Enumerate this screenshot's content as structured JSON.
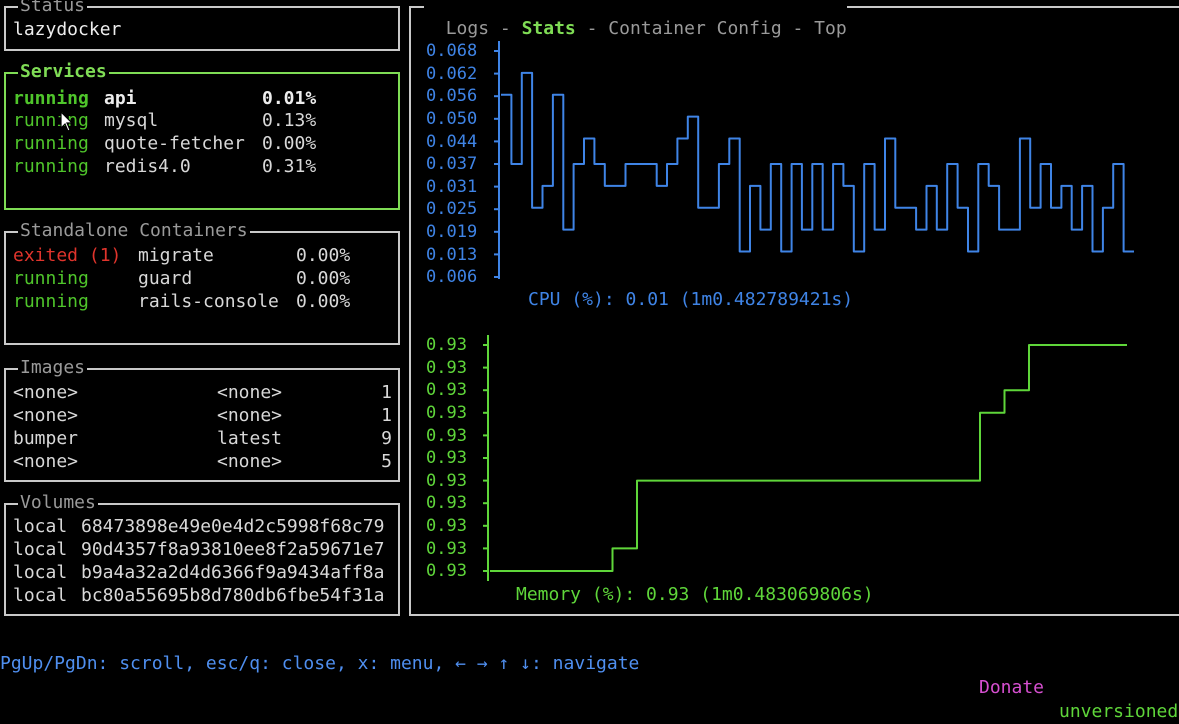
{
  "status": {
    "title": "Status",
    "value": "lazydocker"
  },
  "services": {
    "title": "Services",
    "rows": [
      {
        "state": "running",
        "name": "api",
        "cpu": "0.01%"
      },
      {
        "state": "running",
        "name": "mysql",
        "cpu": "0.13%"
      },
      {
        "state": "running",
        "name": "quote-fetcher",
        "cpu": "0.00%"
      },
      {
        "state": "running",
        "name": "redis4.0",
        "cpu": "0.31%"
      }
    ]
  },
  "standalone": {
    "title": "Standalone Containers",
    "rows": [
      {
        "state": "exited (1)",
        "name": "migrate",
        "cpu": "0.00%"
      },
      {
        "state": "running",
        "name": "guard",
        "cpu": "0.00%"
      },
      {
        "state": "running",
        "name": "rails-console",
        "cpu": "0.00%"
      }
    ]
  },
  "images": {
    "title": "Images",
    "rows": [
      {
        "name": "<none>",
        "tag": "<none>",
        "size": "1"
      },
      {
        "name": "<none>",
        "tag": "<none>",
        "size": "1"
      },
      {
        "name": "bumper",
        "tag": "latest",
        "size": "9"
      },
      {
        "name": "<none>",
        "tag": "<none>",
        "size": "5"
      }
    ]
  },
  "volumes": {
    "title": "Volumes",
    "rows": [
      {
        "driver": "local",
        "name": "68473898e49e0e4d2c5998f68c79"
      },
      {
        "driver": "local",
        "name": "90d4357f8a93810ee8f2a59671e7"
      },
      {
        "driver": "local",
        "name": "b9a4a32a2d4d6366f9a9434aff8a"
      },
      {
        "driver": "local",
        "name": "bc80a55695b8d780db6fbe54f31a"
      }
    ]
  },
  "main": {
    "tabs": [
      {
        "label": "Logs",
        "selected": false
      },
      {
        "label": "Stats",
        "selected": true
      },
      {
        "label": "Container Config",
        "selected": false
      },
      {
        "label": "Top",
        "selected": false
      }
    ],
    "tab_separator": " - "
  },
  "chart_data": [
    {
      "type": "line",
      "title": "CPU (%): 0.01 (1m0.482789421s)",
      "color": "#3f84e6",
      "yticks": [
        "0.068",
        "0.062",
        "0.056",
        "0.050",
        "0.044",
        "0.037",
        "0.031",
        "0.025",
        "0.019",
        "0.013",
        "0.006"
      ],
      "ylim": [
        0.006,
        0.068
      ],
      "y": [
        0.056,
        0.037,
        0.062,
        0.025,
        0.031,
        0.056,
        0.019,
        0.037,
        0.044,
        0.037,
        0.031,
        0.031,
        0.037,
        0.037,
        0.037,
        0.031,
        0.037,
        0.044,
        0.05,
        0.025,
        0.025,
        0.037,
        0.044,
        0.013,
        0.031,
        0.019,
        0.037,
        0.013,
        0.037,
        0.019,
        0.037,
        0.019,
        0.037,
        0.031,
        0.013,
        0.037,
        0.019,
        0.044,
        0.025,
        0.025,
        0.019,
        0.031,
        0.019,
        0.037,
        0.025,
        0.013,
        0.037,
        0.031,
        0.019,
        0.019,
        0.044,
        0.025,
        0.037,
        0.025,
        0.031,
        0.019,
        0.031,
        0.013,
        0.025,
        0.037,
        0.013
      ],
      "grid": false
    },
    {
      "type": "line",
      "title": "Memory (%): 0.93 (1m0.483069806s)",
      "color": "#5fd63a",
      "yticks": [
        "0.93",
        "0.93",
        "0.93",
        "0.93",
        "0.93",
        "0.93",
        "0.93",
        "0.93",
        "0.93",
        "0.93",
        "0.93"
      ],
      "y": [
        0.93,
        0.93,
        0.93,
        0.93,
        0.93,
        0.93,
        0.93,
        0.93,
        0.93,
        0.93,
        0.93,
        0.93,
        0.93,
        0.93,
        0.93,
        0.93,
        0.93,
        0.93,
        0.93,
        0.93,
        0.93,
        0.93,
        0.93,
        0.93,
        0.93,
        0.93
      ],
      "levels": [
        0,
        0,
        0,
        0,
        0,
        1,
        4,
        4,
        4,
        4,
        4,
        4,
        4,
        4,
        4,
        4,
        4,
        4,
        4,
        4,
        7,
        8,
        10,
        10,
        10,
        10
      ],
      "grid": false
    }
  ],
  "footer": {
    "keys": "PgUp/PgDn: scroll, esc/q: close, x: menu, ← → ↑ ↓: navigate",
    "donate": "Donate",
    "version": "unversioned"
  }
}
